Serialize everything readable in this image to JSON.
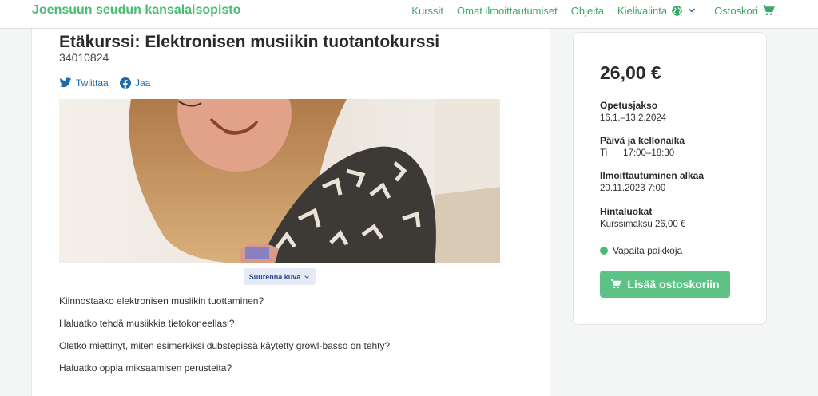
{
  "header": {
    "brand": "Joensuun seudun kansalaisopisto",
    "nav": {
      "courses": "Kurssit",
      "my_registrations": "Omat ilmoittautumiset",
      "help": "Ohjeita",
      "language": "Kielivalinta",
      "cart": "Ostoskori"
    }
  },
  "course": {
    "title": "Etäkurssi: Elektronisen musiikin tuotantokurssi",
    "code": "34010824",
    "share": {
      "twitter": "Twiittaa",
      "facebook": "Jaa"
    },
    "enlarge_image": "Suurenna kuva",
    "description": [
      "Kiinnostaako elektronisen musiikin tuottaminen?",
      "Haluatko tehdä musiikkia tietokoneellasi?",
      "Oletko miettinyt, miten esimerkiksi dubstepissä käytetty growl-basso on tehty?",
      "Haluatko oppia miksaamisen perusteita?"
    ]
  },
  "sidebar": {
    "price": "26,00 €",
    "period": {
      "label": "Opetusjakso",
      "value": "16.1.–13.2.2024"
    },
    "schedule": {
      "label": "Päivä ja kellonaika",
      "day": "Ti",
      "time": "17:00–18:30"
    },
    "registration": {
      "label": "Ilmoittautuminen alkaa",
      "value": "20.11.2023 7:00"
    },
    "pricing": {
      "label": "Hintaluokat",
      "value": "Kurssimaksu 26,00 €"
    },
    "availability": "Vapaita paikkoja",
    "add_to_cart": "Lisää ostoskoriin"
  },
  "colors": {
    "brand_green": "#4bbb74",
    "button_green": "#5cc286",
    "link_blue": "#1f6aa8",
    "enlarge_bg": "#e5eaf6"
  },
  "icons": [
    "twitter-icon",
    "facebook-icon",
    "globe-icon",
    "chevron-down-icon",
    "cart-icon",
    "status-dot"
  ]
}
